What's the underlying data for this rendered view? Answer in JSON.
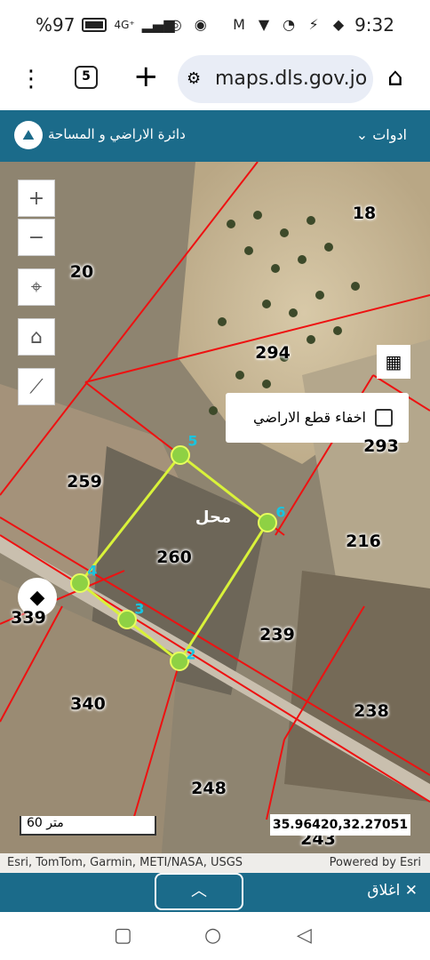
{
  "status_bar": {
    "battery": "%97",
    "network": "4G⁺",
    "time": "9:32"
  },
  "browser": {
    "tab_count": "5",
    "url": "maps.dls.gov.jo"
  },
  "app": {
    "title": "دائرة الاراضي و المساحة",
    "tools_label": "ادوات"
  },
  "map": {
    "hide_parcels_label": "اخفاء قطع الاراضي",
    "parcel_numbers": [
      "18",
      "20",
      "294",
      "293",
      "259",
      "216",
      "260",
      "239",
      "339",
      "340",
      "238",
      "248",
      "243"
    ],
    "vertex_labels": [
      "2",
      "3",
      "4",
      "5",
      "6"
    ],
    "handwritten": "محل",
    "scale_label": "60 متر",
    "coordinates": "35.96420,32.27051",
    "attribution_left": "Esri, TomTom, Garmin, METI/NASA, USGS",
    "attribution_right": "Powered by Esri"
  },
  "bottom": {
    "close_label": "اغلاق"
  }
}
